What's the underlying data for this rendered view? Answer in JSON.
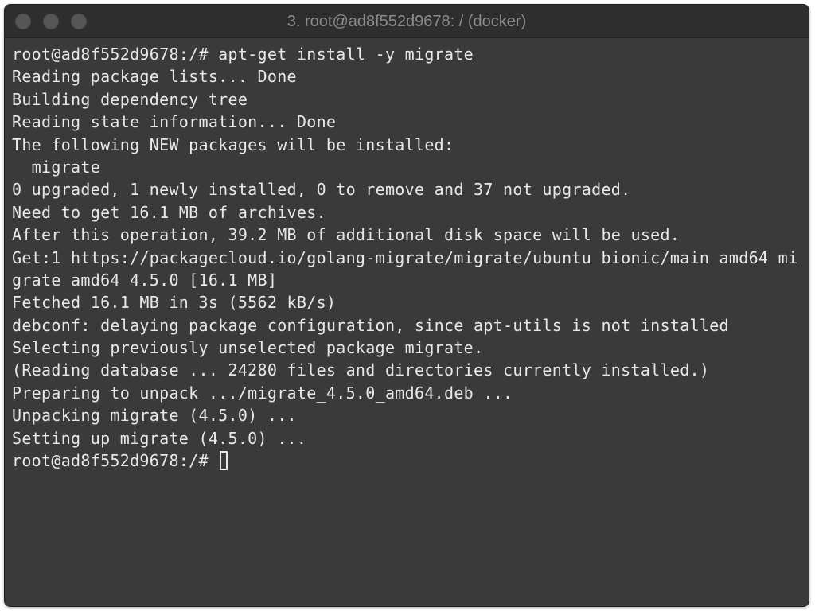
{
  "window": {
    "title": "3. root@ad8f552d9678: / (docker)"
  },
  "terminal": {
    "lines": [
      "root@ad8f552d9678:/# apt-get install -y migrate",
      "Reading package lists... Done",
      "Building dependency tree",
      "Reading state information... Done",
      "The following NEW packages will be installed:",
      "  migrate",
      "0 upgraded, 1 newly installed, 0 to remove and 37 not upgraded.",
      "Need to get 16.1 MB of archives.",
      "After this operation, 39.2 MB of additional disk space will be used.",
      "Get:1 https://packagecloud.io/golang-migrate/migrate/ubuntu bionic/main amd64 mi",
      "grate amd64 4.5.0 [16.1 MB]",
      "Fetched 16.1 MB in 3s (5562 kB/s)",
      "debconf: delaying package configuration, since apt-utils is not installed",
      "Selecting previously unselected package migrate.",
      "(Reading database ... 24280 files and directories currently installed.)",
      "Preparing to unpack .../migrate_4.5.0_amd64.deb ...",
      "Unpacking migrate (4.5.0) ...",
      "Setting up migrate (4.5.0) ..."
    ],
    "prompt": "root@ad8f552d9678:/# "
  },
  "colors": {
    "background": "#3a3a3a",
    "titlebar": "#2e2e2e",
    "text": "#e8e8e8",
    "title_text": "#8c8c8c"
  }
}
